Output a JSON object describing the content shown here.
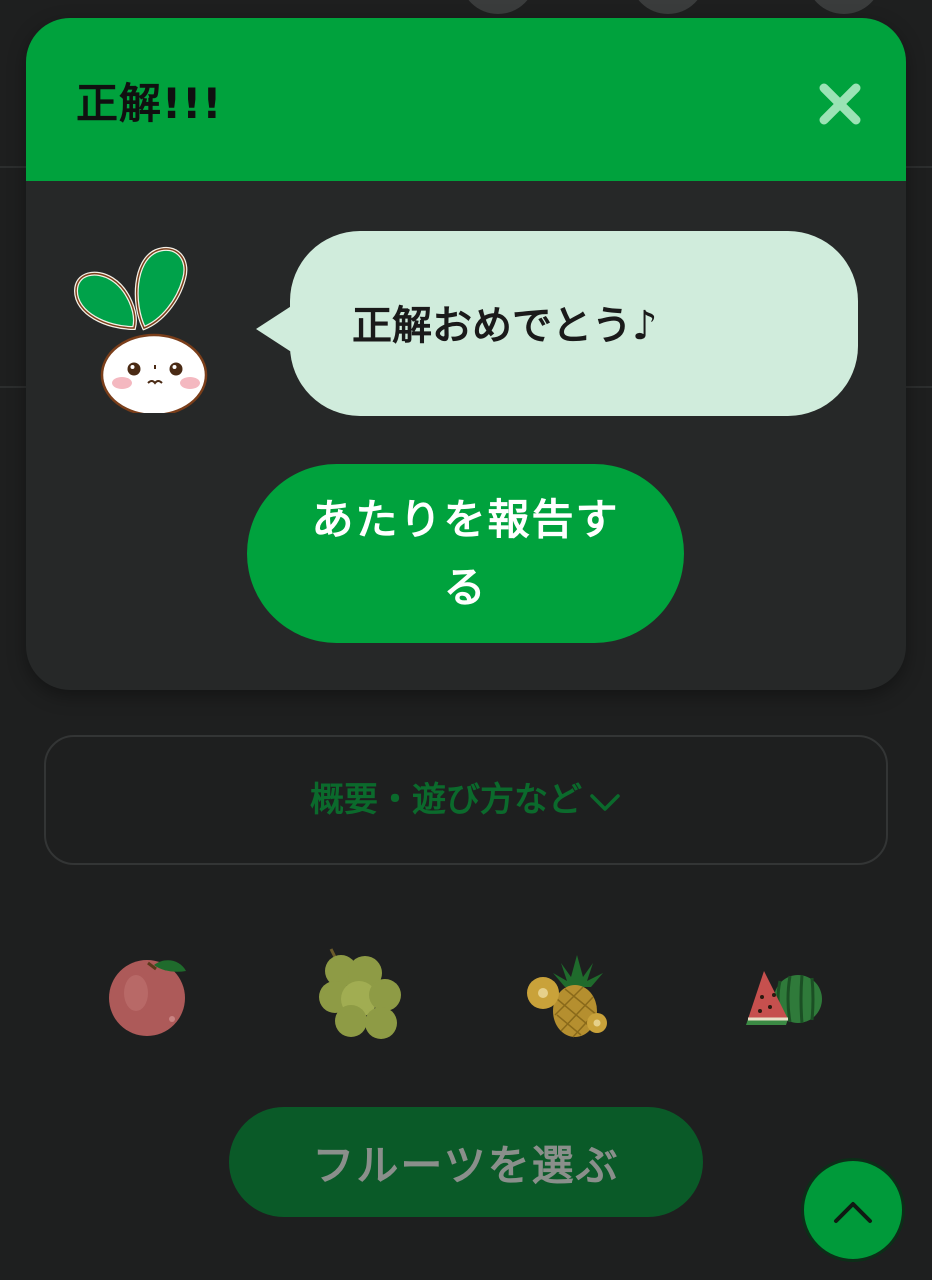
{
  "dialog": {
    "title": "正解!!!",
    "close_icon": "close-icon",
    "message": "正解おめでとう♪",
    "report_button_label": "あたりを報告する"
  },
  "overview": {
    "label": "概要・遊び方など",
    "chevron_icon": "chevron-down-icon"
  },
  "fruits": [
    {
      "name": "peach-icon"
    },
    {
      "name": "grapes-icon"
    },
    {
      "name": "pineapple-icon"
    },
    {
      "name": "watermelon-icon"
    }
  ],
  "choose_button_label": "フルーツを選ぶ",
  "scroll_top_icon": "chevron-up-icon",
  "colors": {
    "accent_green": "#00a23d",
    "dark_green": "#0a5a28",
    "bubble": "#d0ecdc",
    "background": "#1e1f1f"
  }
}
